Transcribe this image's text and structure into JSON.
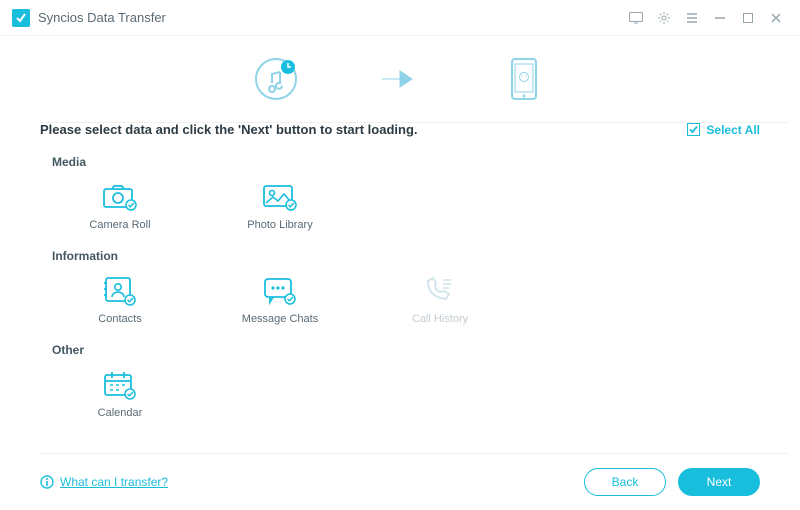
{
  "titlebar": {
    "title": "Syncios Data Transfer"
  },
  "instruction": "Please select data and click the 'Next' button to start loading.",
  "select_all": "Select All",
  "sections": {
    "media": {
      "label": "Media",
      "items": [
        {
          "name": "Camera Roll",
          "enabled": true,
          "icon": "camera"
        },
        {
          "name": "Photo Library",
          "enabled": true,
          "icon": "photo"
        }
      ]
    },
    "information": {
      "label": "Information",
      "items": [
        {
          "name": "Contacts",
          "enabled": true,
          "icon": "contacts"
        },
        {
          "name": "Message Chats",
          "enabled": true,
          "icon": "message"
        },
        {
          "name": "Call History",
          "enabled": false,
          "icon": "callhistory"
        }
      ]
    },
    "other": {
      "label": "Other",
      "items": [
        {
          "name": "Calendar",
          "enabled": true,
          "icon": "calendar"
        }
      ]
    }
  },
  "footer": {
    "help": "What can I transfer?",
    "back": "Back",
    "next": "Next"
  },
  "colors": {
    "accent": "#1abedd",
    "hero": "#8fd3e8",
    "disabled": "#cfe4ea"
  }
}
